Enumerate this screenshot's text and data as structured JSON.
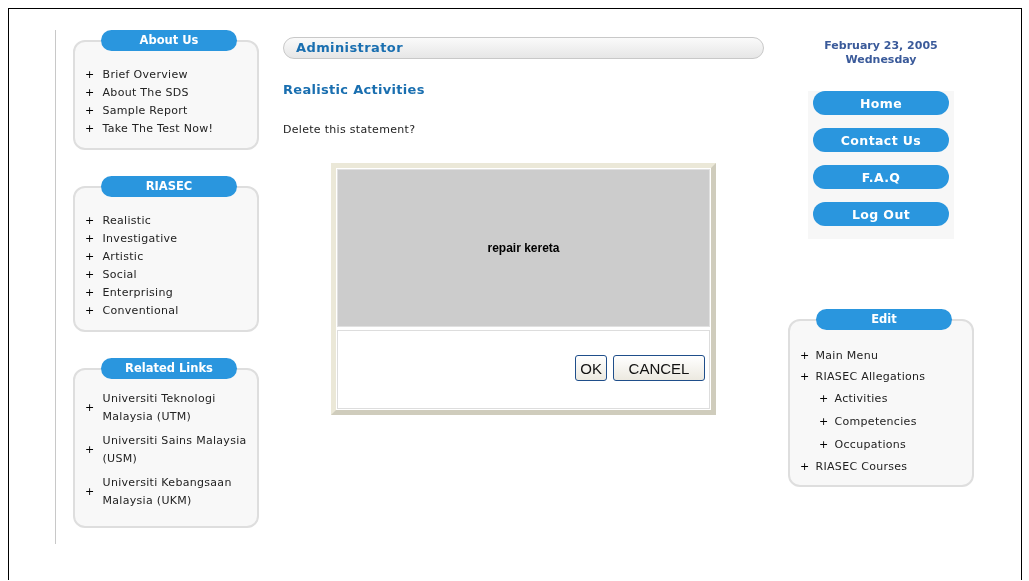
{
  "left_panels": [
    {
      "title": "About Us",
      "items": [
        {
          "mark": "+",
          "label": "Brief Overview"
        },
        {
          "mark": "+",
          "label": "About The SDS"
        },
        {
          "mark": "+",
          "label": "Sample Report"
        },
        {
          "mark": "+",
          "label": "Take The Test Now!"
        }
      ]
    },
    {
      "title": "RIASEC",
      "items": [
        {
          "mark": "+",
          "label": "Realistic"
        },
        {
          "mark": "+",
          "label": "Investigative"
        },
        {
          "mark": "+",
          "label": "Artistic"
        },
        {
          "mark": "+",
          "label": "Social"
        },
        {
          "mark": "+",
          "label": "Enterprising"
        },
        {
          "mark": "+",
          "label": "Conventional"
        }
      ]
    },
    {
      "title": "Related Links",
      "items": [
        {
          "mark": "+",
          "label": "Universiti Teknologi Malaysia (UTM)"
        },
        {
          "mark": "+",
          "label": "Universiti Sains Malaysia (USM)"
        },
        {
          "mark": "+",
          "label": "Universiti Kebangsaan Malaysia (UKM)"
        }
      ]
    }
  ],
  "header_bar": {
    "title": "Administrator"
  },
  "page_title": "Realistic Activities",
  "prompt": "Delete this statement?",
  "dialog": {
    "statement": "repair kereta",
    "buttons": [
      "OK",
      "CANCEL"
    ]
  },
  "date": {
    "line_1": "February 23, 2005",
    "line_2": "Wednesday"
  },
  "nav_buttons": [
    "Home",
    "Contact Us",
    "F.A.Q",
    "Log Out"
  ],
  "edit_panel": {
    "title": "Edit",
    "items": [
      {
        "mark": "+",
        "label": "Main Menu"
      },
      {
        "mark": "+",
        "label": "RIASEC Allegations",
        "children": [
          {
            "mark": "+",
            "label": "Activities"
          },
          {
            "mark": "+",
            "label": "Competencies"
          },
          {
            "mark": "+",
            "label": "Occupations"
          }
        ]
      },
      {
        "mark": "+",
        "label": "RIASEC Courses"
      }
    ]
  }
}
